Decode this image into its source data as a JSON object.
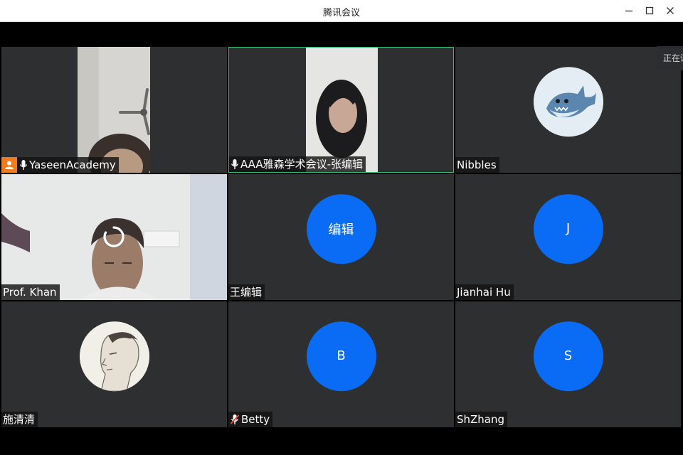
{
  "window": {
    "title": "腾讯会议",
    "controls": [
      "minimize",
      "maximize",
      "close"
    ]
  },
  "floating_tip": "正在讲",
  "participants": [
    {
      "name": "YaseenAcademy",
      "host": true,
      "mic": "on",
      "view": "camera"
    },
    {
      "name": "AAA雅森学术会议-张编辑",
      "host": false,
      "mic": "on",
      "view": "camera",
      "active_speaker": true
    },
    {
      "name": "Nibbles",
      "host": false,
      "mic": "none",
      "view": "avatar-image",
      "avatar_icon": "shark-icon"
    },
    {
      "name": "Prof. Khan",
      "host": false,
      "mic": "none",
      "view": "camera",
      "loading": true
    },
    {
      "name": "王编辑",
      "host": false,
      "mic": "none",
      "view": "avatar",
      "avatar_text": "编辑"
    },
    {
      "name": "Jianhai Hu",
      "host": false,
      "mic": "none",
      "view": "avatar",
      "avatar_text": "J"
    },
    {
      "name": "施清清",
      "host": false,
      "mic": "none",
      "view": "avatar-image",
      "avatar_icon": "sketch-portrait-icon"
    },
    {
      "name": "Betty",
      "host": false,
      "mic": "muted",
      "view": "avatar",
      "avatar_text": "B"
    },
    {
      "name": "ShZhang",
      "host": false,
      "mic": "none",
      "view": "avatar",
      "avatar_text": "S"
    }
  ],
  "colors": {
    "tile_bg": "#2d2f31",
    "avatar_blue": "#0a6cf5",
    "active_border": "#2fbf71",
    "host_badge": "#f07c22",
    "muted_red": "#e5484d"
  }
}
